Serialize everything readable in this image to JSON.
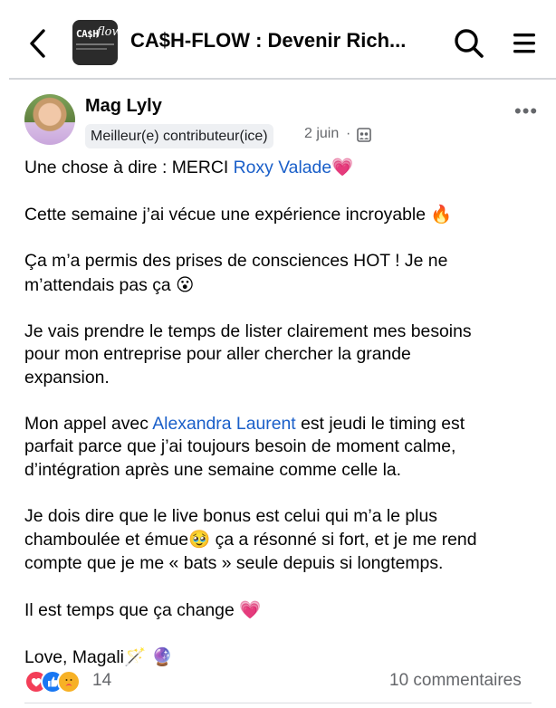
{
  "header": {
    "group_title": "CA$H-FLOW : Devenir Rich...",
    "thumb_text_a": "CA$H",
    "thumb_text_b": "flow"
  },
  "post": {
    "author": "Mag Lyly",
    "badge": "Meilleur(e) contributeur(ice)",
    "date": "2 juin",
    "dot": "·",
    "body": {
      "p1_pre": "Une chose à dire : MERCI ",
      "p1_link": "Roxy Valade",
      "p1_emoji": "💗",
      "p2_text": "Cette semaine j’ai vécue une expérience incroyable ",
      "p2_emoji": "🔥",
      "p3_line1": "Ça m’a permis des prises de consciences HOT ! Je ne",
      "p3_line2": "m’attendais pas ça ",
      "p3_emoji": "😮",
      "p4_line1": "Je vais prendre le temps de lister clairement mes besoins",
      "p4_line2": "pour mon entreprise pour aller chercher la grande",
      "p4_line3": "expansion.",
      "p5_pre": "Mon appel avec ",
      "p5_link": "Alexandra Laurent",
      "p5_post": " est jeudi le timing est",
      "p5_line2": "parfait parce que j’ai toujours besoin de moment calme,",
      "p5_line3": "d’intégration après une semaine comme celle la.",
      "p6_line1": "Je dois dire que le live bonus est celui qui m’a le plus",
      "p6_line2_pre": "chamboulée et émue",
      "p6_emoji": "🥹",
      "p6_line2_post": " ça a résonné si fort, et je me rend",
      "p6_line3": "compte que je me « bats » seule depuis si longtemps.",
      "p7_text": "Il est temps que ça change ",
      "p7_emoji": "💗",
      "p8_text": "Love, Magali",
      "p8_emoji": "🪄 🔮"
    }
  },
  "footer": {
    "reaction_count": "14",
    "comments": "10 commentaires",
    "reactions": [
      "love-icon",
      "like-icon",
      "care-icon"
    ]
  },
  "colors": {
    "link": "#1a5fc9",
    "secondary_text": "#65676b",
    "badge_bg": "#eef0f3"
  }
}
